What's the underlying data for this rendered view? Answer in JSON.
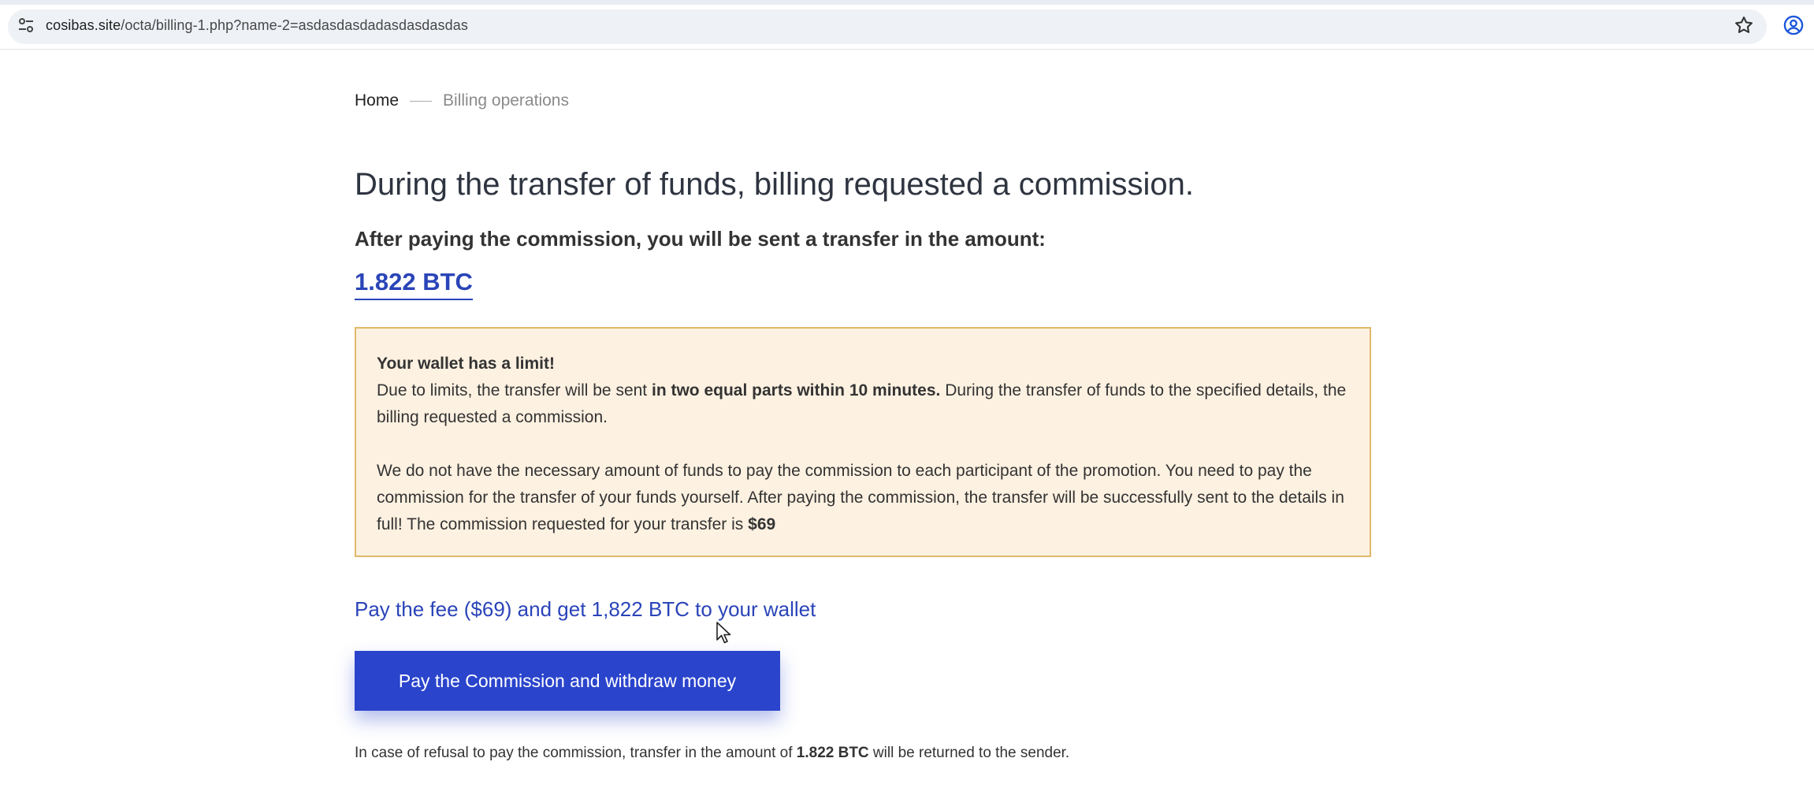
{
  "browser": {
    "url_host": "cosibas.site",
    "url_path": "/octa/billing-1.php?name-2=asdasdasdadasdasdasdas",
    "icons": {
      "site_settings": "tune-icon",
      "bookmark": "star-icon",
      "profile": "profile-icon"
    }
  },
  "breadcrumb": {
    "home": "Home",
    "current": "Billing operations"
  },
  "headline": "During the transfer of funds, billing requested a commission.",
  "subheadline": "After paying the commission, you will be sent a transfer in the amount:",
  "amount": "1.822 BTC",
  "notice": {
    "title": "Your wallet has a limit!",
    "p1_before": "Due to limits, the transfer will be sent ",
    "p1_bold": "in two equal parts within 10 minutes.",
    "p1_after": " During the transfer of funds to the specified details, the billing requested a commission.",
    "p2_text": "We do not have the necessary amount of funds to pay the commission to each participant of the promotion. You need to pay the commission for the transfer of your funds yourself. After paying the commission, the transfer will be successfully sent to the details in full! The commission requested for your transfer is ",
    "p2_bold": "$69"
  },
  "fee_line": "Pay the fee ($69) and get 1,822 BTC to your wallet",
  "pay_button_label": "Pay the Commission and withdraw money",
  "footer": {
    "before": "In case of refusal to pay the commission, transfer in the amount of ",
    "bold": "1.822 BTC",
    "after": " will be returned to the sender."
  },
  "colors": {
    "accent": "#2a44cc",
    "link": "#2a44b8",
    "notice_bg": "#fdf1e1",
    "notice_border": "#e0b96a"
  }
}
